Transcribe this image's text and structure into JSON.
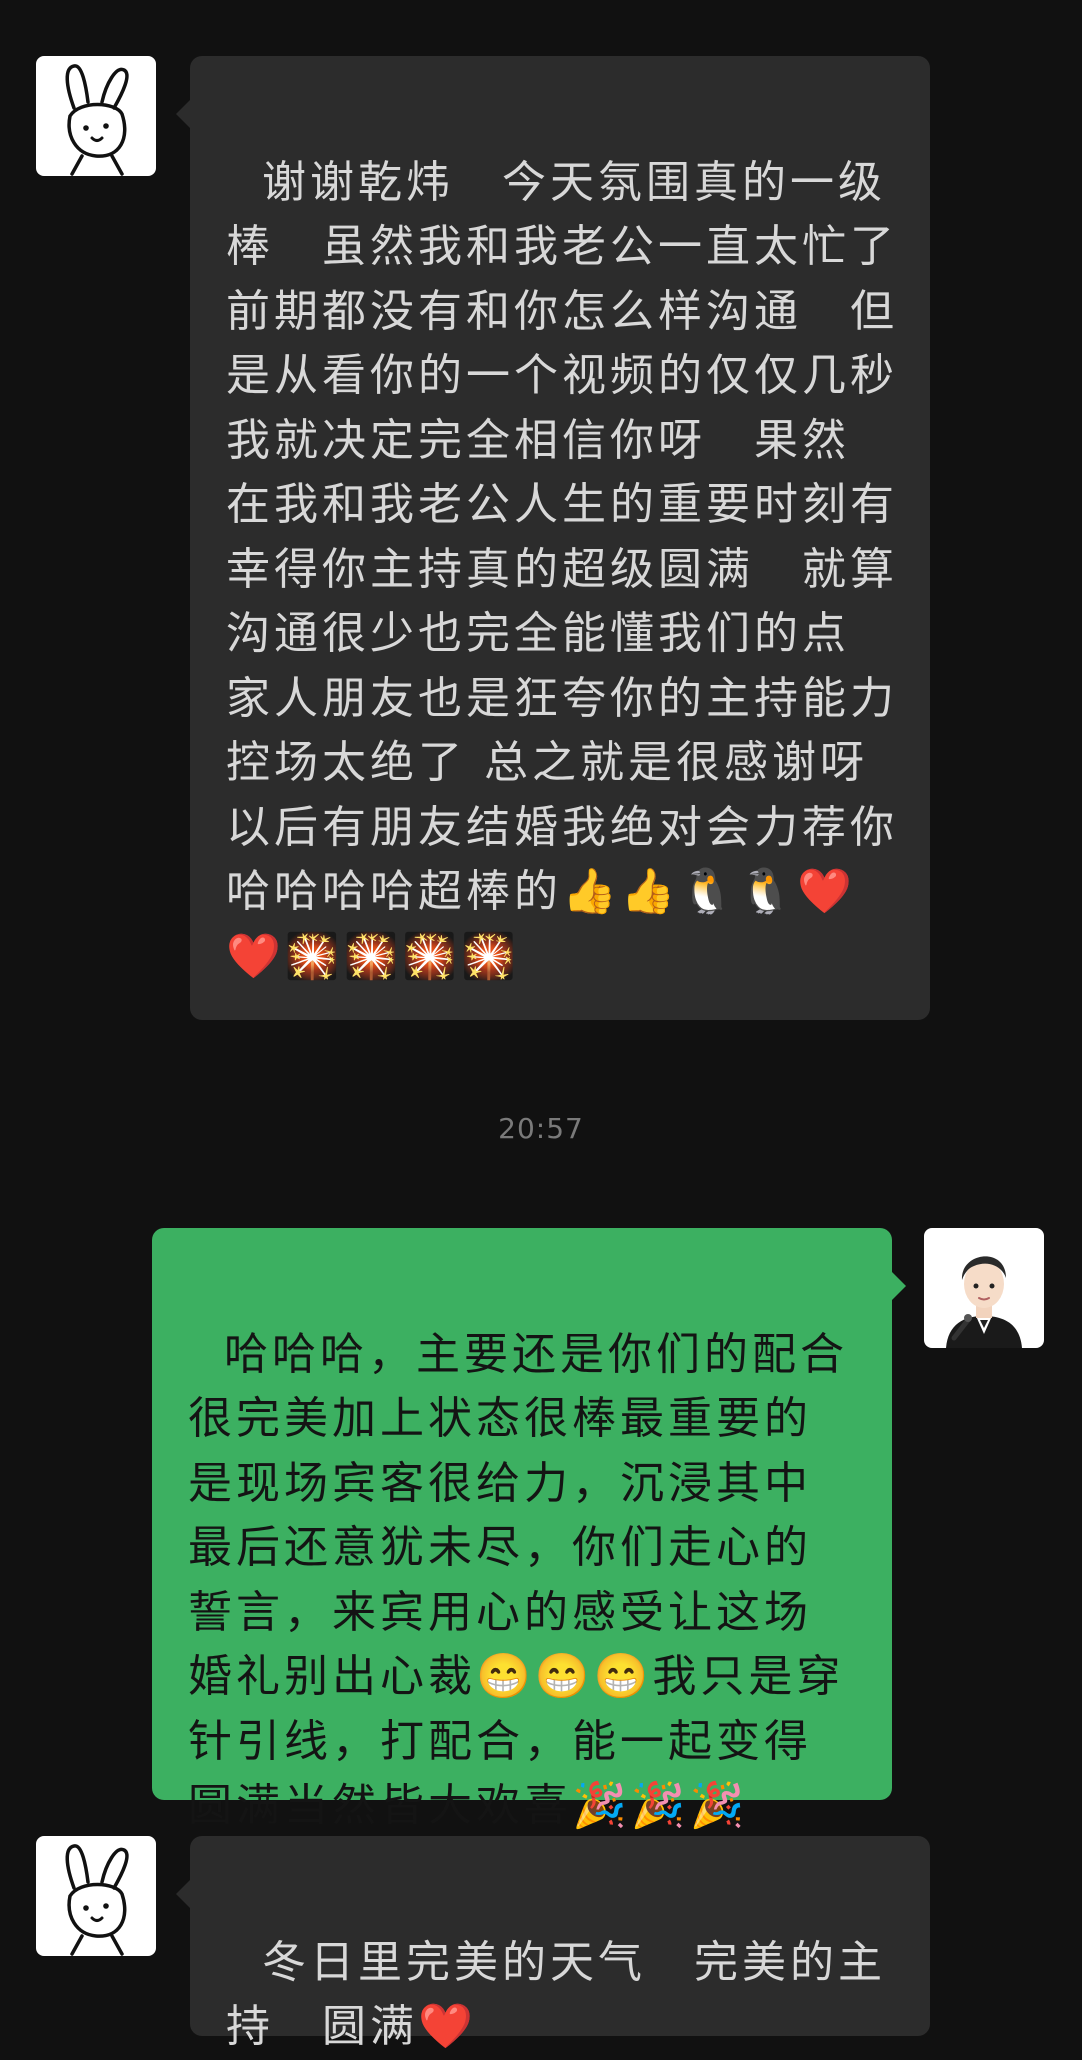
{
  "header_fragment": "",
  "messages": [
    {
      "sender": "other",
      "avatar_icon": "bunny-avatar-icon",
      "text": "谢谢乾炜　今天氛围真的一级棒　虽然我和我老公一直太忙了前期都没有和你怎么样沟通　但是从看你的一个视频的仅仅几秒我就决定完全相信你呀　果然 在我和我老公人生的重要时刻有幸得你主持真的超级圆满　就算沟通很少也完全能懂我们的点　家人朋友也是狂夸你的主持能力　控场太绝了 总之就是很感谢呀　以后有朋友结婚我绝对会力荐你哈哈哈哈超棒的👍👍🐧🐧❤️❤️🎇🎇🎇🎇"
    },
    {
      "type": "timestamp",
      "text": "20:57"
    },
    {
      "sender": "self",
      "avatar_icon": "host-avatar-icon",
      "text": "哈哈哈，主要还是你们的配合很完美加上状态很棒最重要的是现场宾客很给力，沉浸其中最后还意犹未尽，你们走心的誓言，来宾用心的感受让这场婚礼别出心裁😁😁😁我只是穿针引线，打配合，能一起变得圆满当然皆大欢喜🎉🎉🎉"
    },
    {
      "sender": "other",
      "avatar_icon": "bunny-avatar-icon",
      "text": "冬日里完美的天气　完美的主持　圆满❤️"
    }
  ],
  "colors": {
    "background": "#111111",
    "incoming_bubble": "#2c2c2c",
    "outgoing_bubble": "#3cb061",
    "timestamp": "#7a7a7a"
  }
}
